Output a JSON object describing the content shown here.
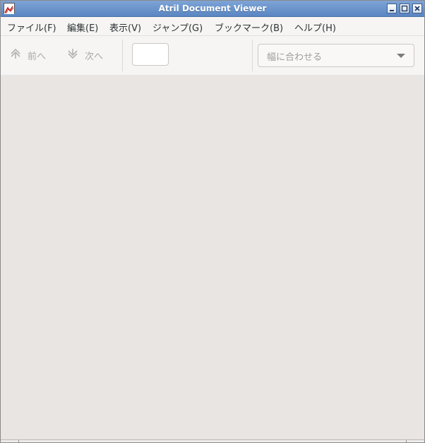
{
  "window": {
    "title": "Atril Document Viewer"
  },
  "menu": [
    {
      "label": "ファイル(F)"
    },
    {
      "label": "編集(E)"
    },
    {
      "label": "表示(V)"
    },
    {
      "label": "ジャンプ(G)"
    },
    {
      "label": "ブックマーク(B)"
    },
    {
      "label": "ヘルプ(H)"
    }
  ],
  "toolbar": {
    "prev_label": "前へ",
    "next_label": "次へ",
    "page_value": "",
    "zoom_selected": "幅に合わせる"
  },
  "icons": {
    "app": "atril-app-icon",
    "minimize": "minimize-icon",
    "maximize": "maximize-icon",
    "close": "close-icon",
    "prev": "arrow-up-icon",
    "next": "arrow-down-icon",
    "dropdown": "chevron-down-icon"
  },
  "colors": {
    "titlebar": "#6b94cb",
    "toolbar": "#f6f5f4",
    "viewer": "#e8e5e2"
  }
}
